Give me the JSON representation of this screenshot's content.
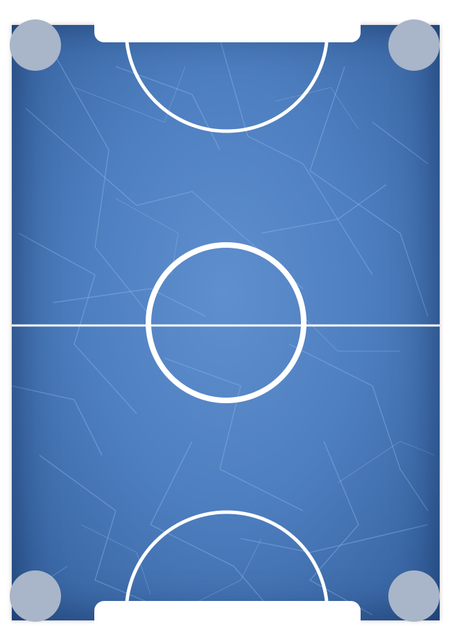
{
  "game": {
    "surface": "air-hockey-rink",
    "colors": {
      "ice": "#5a8bcb",
      "ice_edge": "#2f5a95",
      "ice_scratches": "#8fb6ec",
      "lines": "#ffffff",
      "corner_pockets": "#a9b5c8",
      "background": "#ffffff"
    },
    "markings": [
      "center-line",
      "center-circle",
      "top-goal-crease",
      "bottom-goal-crease"
    ],
    "corner_pockets": [
      "top-left",
      "top-right",
      "bottom-left",
      "bottom-right"
    ]
  }
}
